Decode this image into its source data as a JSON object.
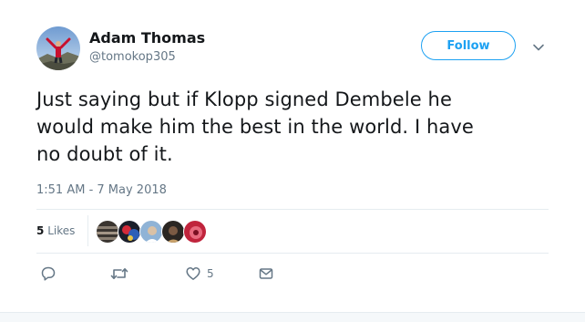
{
  "user": {
    "name": "Adam Thomas",
    "handle": "@tomokop305"
  },
  "follow_button": {
    "label": "Follow"
  },
  "tweet": {
    "text_line1": "Just saying but if Klopp signed Dembele he",
    "text_line2": "would make him the best in the world. I have",
    "text_line3": "no doubt of it.",
    "timestamp": "1:51 AM - 7 May 2018"
  },
  "stats": {
    "likes_count": "5",
    "likes_label": "Likes"
  },
  "actions": {
    "reply_icon": "reply-icon",
    "retweet_icon": "retweet-icon",
    "like_icon": "heart-icon",
    "like_count": "5",
    "dm_icon": "envelope-icon"
  },
  "colors": {
    "accent": "#1da1f2",
    "text": "#14171a",
    "muted": "#657786",
    "border": "#e6ecf0"
  }
}
